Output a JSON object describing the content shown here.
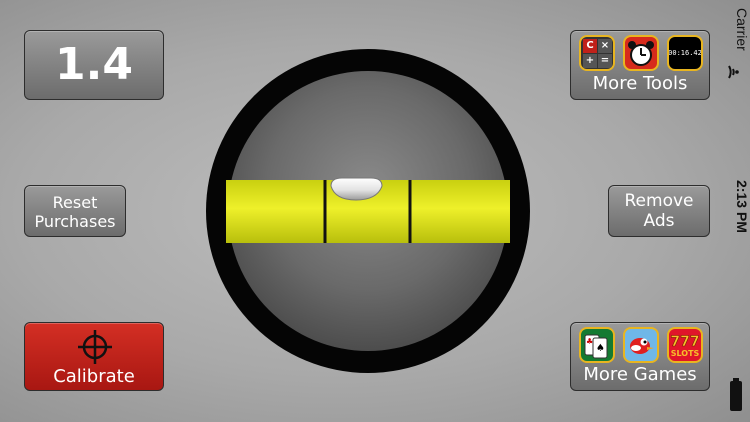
{
  "display": {
    "value": "1.4"
  },
  "buttons": {
    "reset_line1": "Reset",
    "reset_line2": "Purchases",
    "calibrate": "Calibrate",
    "more_tools": "More Tools",
    "remove_line1": "Remove",
    "remove_line2": "Ads",
    "more_games": "More Games"
  },
  "tool_icons": [
    {
      "icon": "calculator-icon",
      "keys": [
        "C",
        "×",
        "+",
        "="
      ]
    },
    {
      "icon": "alarm-clock-icon"
    },
    {
      "icon": "stopwatch-icon",
      "text": "00:16.42"
    }
  ],
  "game_icons": [
    {
      "icon": "solitaire-icon"
    },
    {
      "icon": "flappy-bird-icon"
    },
    {
      "icon": "slots-icon",
      "text": "SLOTS",
      "digits": "777"
    }
  ],
  "status_bar": {
    "carrier": "Carrier",
    "time": "2:13 PM"
  },
  "level": {
    "bubble_offset": 0.0
  },
  "colors": {
    "vial": "#dfe61a",
    "calibrate": "#c0211a",
    "ring": "#050505",
    "button_gray": "#7e7e7e",
    "icon_border": "#e8b520"
  }
}
